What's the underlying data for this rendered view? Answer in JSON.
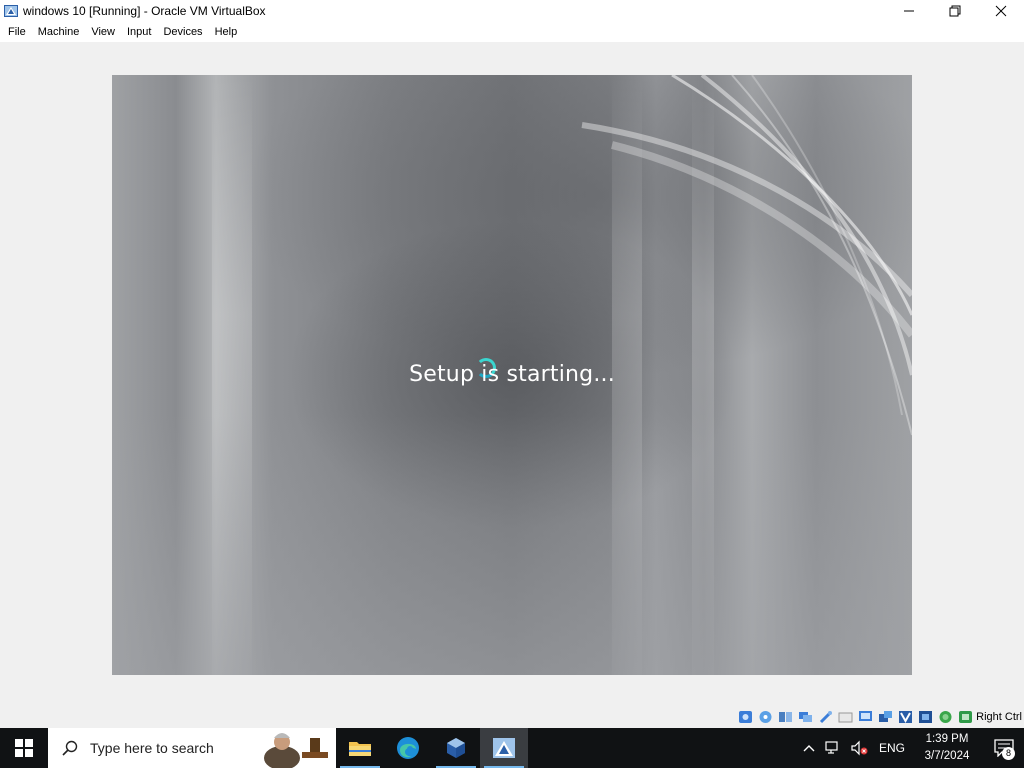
{
  "window": {
    "title": "windows 10 [Running] - Oracle VM VirtualBox",
    "controls": {
      "minimize": "—",
      "maximize": "❐",
      "close": "✕"
    }
  },
  "menu": {
    "items": [
      "File",
      "Machine",
      "View",
      "Input",
      "Devices",
      "Help"
    ]
  },
  "vm": {
    "message": "Setup is starting..."
  },
  "statusbar": {
    "icons": [
      "hard-disk-icon",
      "optical-drive-icon",
      "audio-icon",
      "network-icon",
      "usb-icon",
      "shared-folders-icon",
      "display-icon",
      "video-capture-icon",
      "virtualization-icon",
      "cpu-icon",
      "mouse-integration-icon",
      "keyboard-icon"
    ],
    "host_key": "Right Ctrl"
  },
  "taskbar": {
    "search_placeholder": "Type here to search",
    "apps": [
      "file-explorer-icon",
      "edge-icon",
      "virtualbox-icon",
      "virtualbox-vm-icon"
    ],
    "tray": {
      "language": "ENG",
      "time": "1:39 PM",
      "date": "3/7/2024",
      "notification_count": "8"
    }
  },
  "colors": {
    "taskbar_bg": "#101214",
    "accent_cyan": "#3ad6d0",
    "active_underline": "#76b9ed"
  }
}
